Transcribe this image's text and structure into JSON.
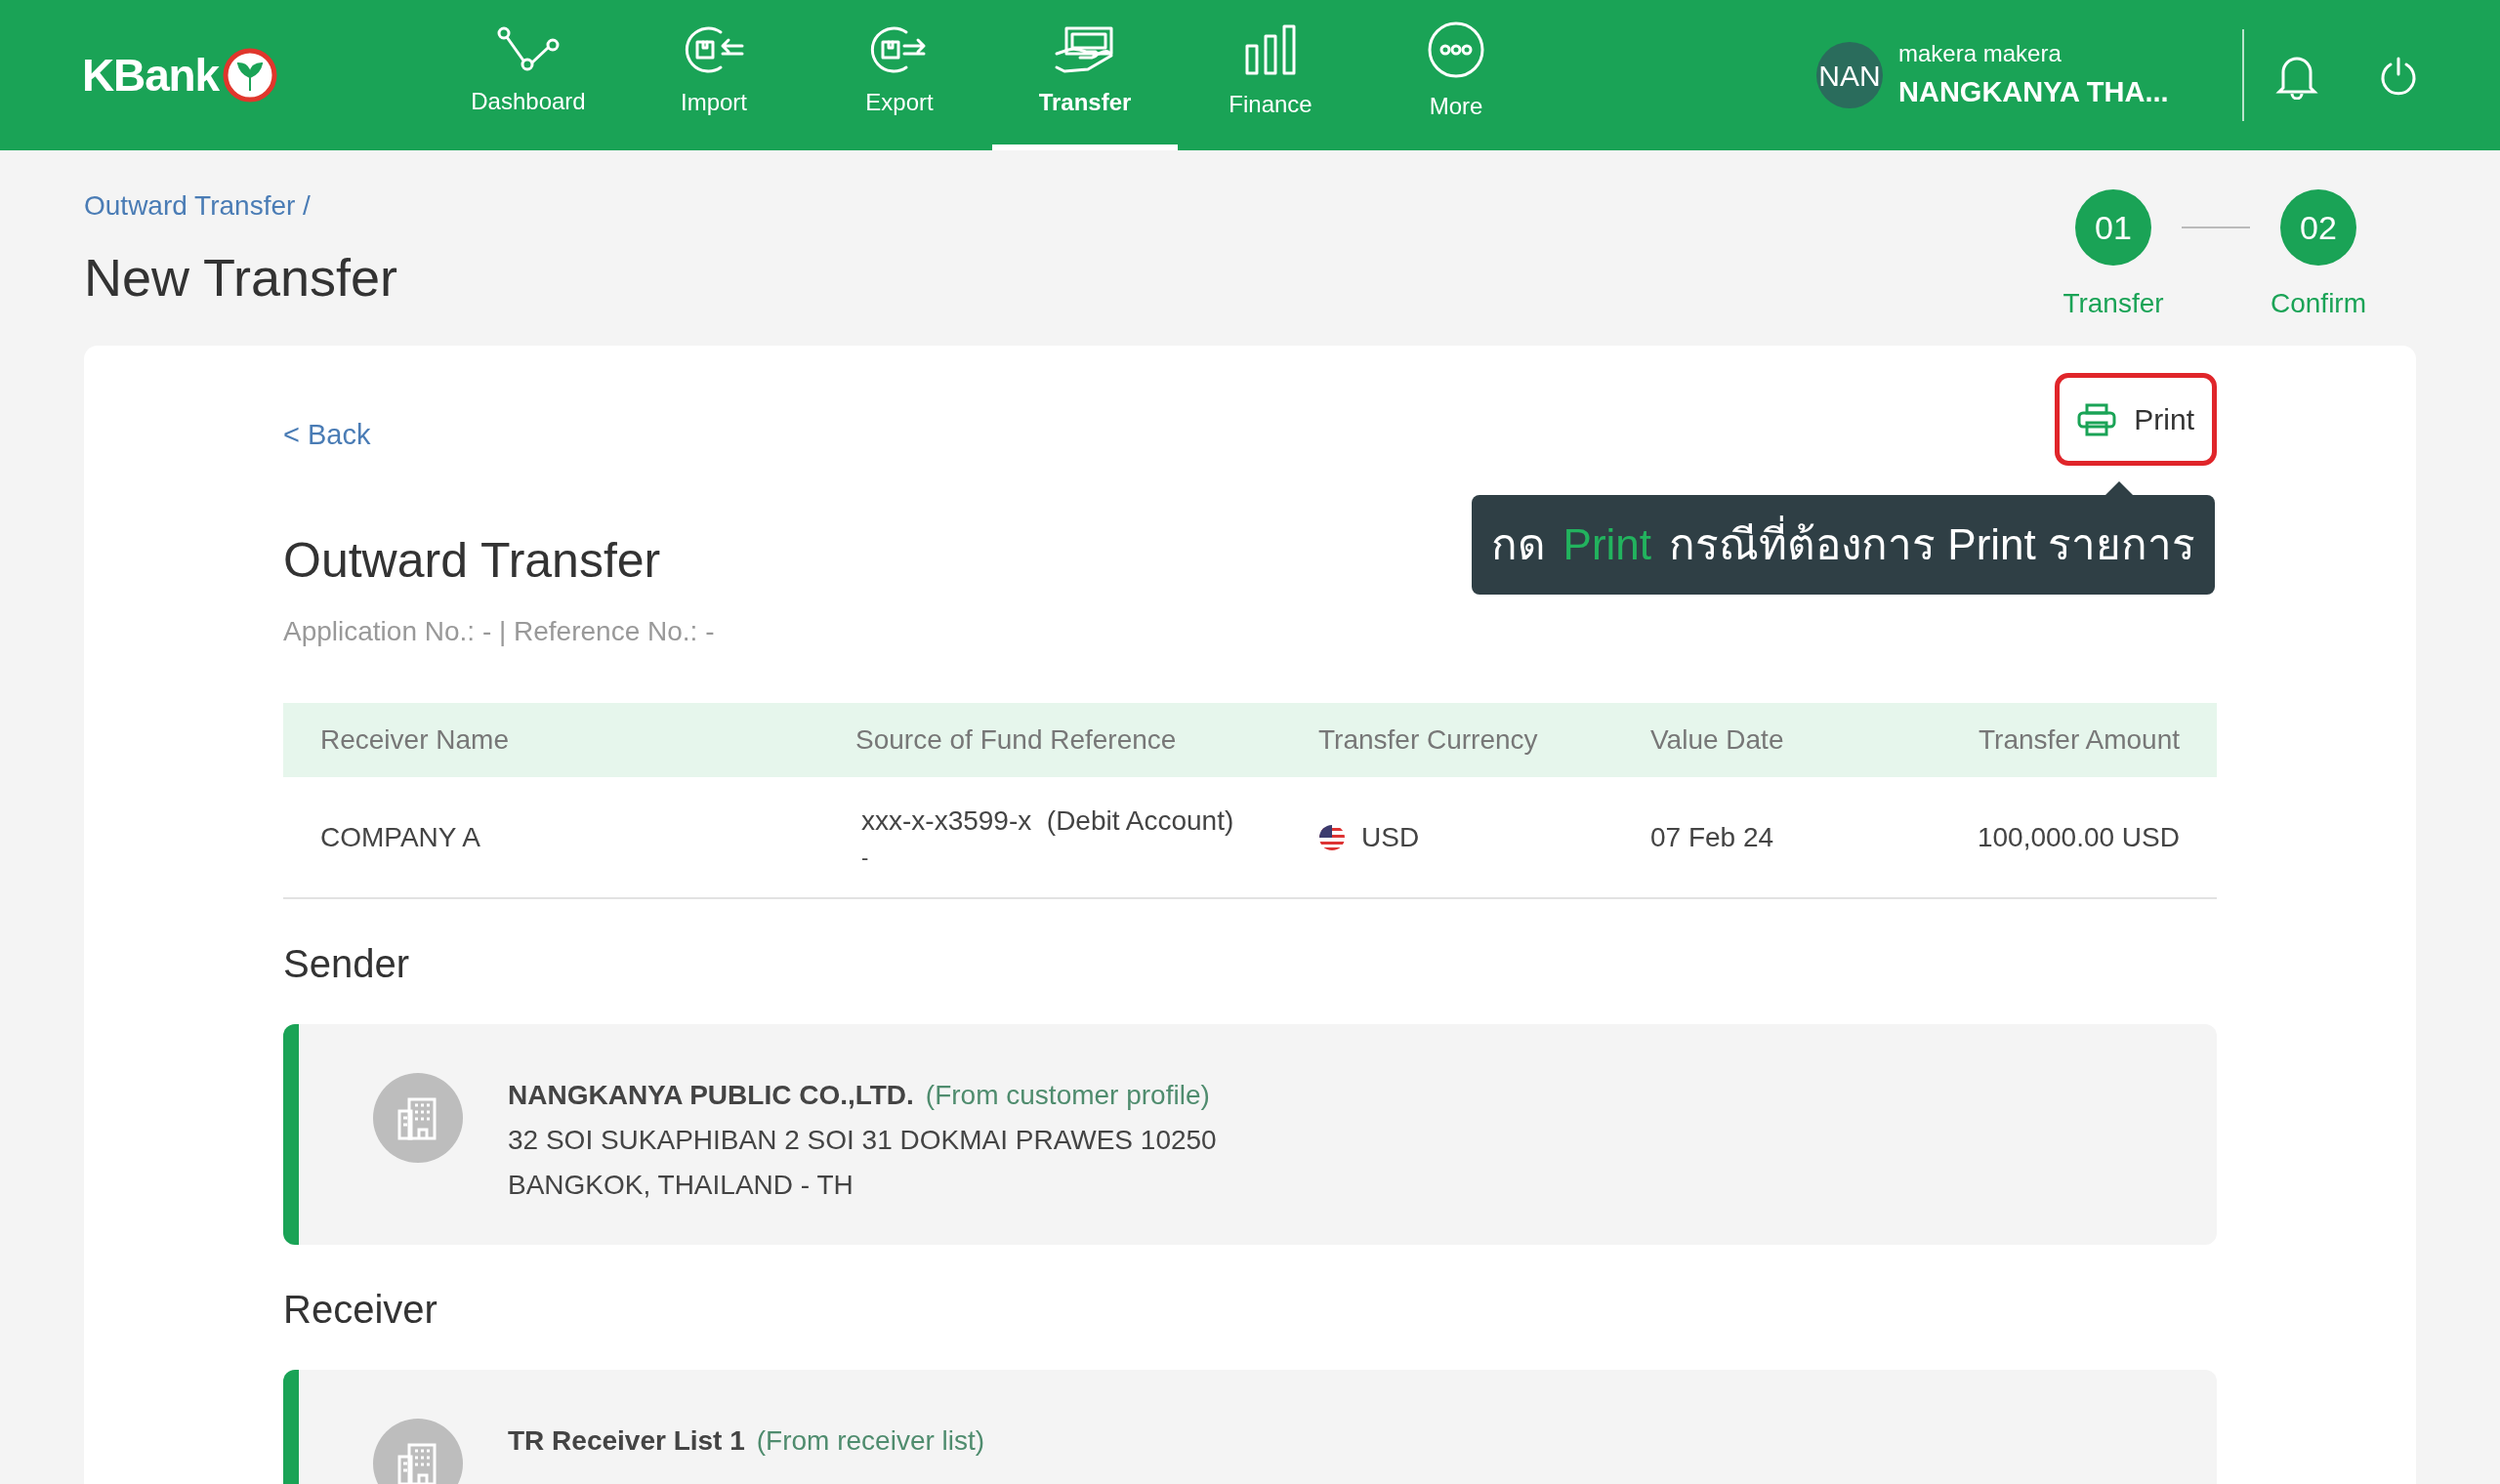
{
  "header": {
    "logo": "KBank",
    "nav": [
      {
        "label": "Dashboard",
        "kind": "dashboard",
        "selected": false
      },
      {
        "label": "Import",
        "kind": "import",
        "selected": false
      },
      {
        "label": "Export",
        "kind": "export",
        "selected": false
      },
      {
        "label": "Transfer",
        "kind": "transfer",
        "selected": true
      },
      {
        "label": "Finance",
        "kind": "finance",
        "selected": false
      },
      {
        "label": "More",
        "kind": "more",
        "selected": false
      }
    ],
    "user": {
      "initials": "NAN",
      "name": "makera makera",
      "company": "NANGKANYA THA..."
    }
  },
  "breadcrumb": "Outward Transfer /",
  "page_title": "New Transfer",
  "steps": [
    {
      "number": "01",
      "label": "Transfer"
    },
    {
      "number": "02",
      "label": "Confirm"
    }
  ],
  "back_link": "< Back",
  "print_button": "Print",
  "tooltip": [
    {
      "text": "กด",
      "highlight": false
    },
    {
      "text": "Print",
      "highlight": true
    },
    {
      "text": "กรณีที่ต้องการ Print รายการ",
      "highlight": false
    }
  ],
  "section_title": "Outward Transfer",
  "section_subtitle": "Application No.: - | Reference No.: -",
  "table": {
    "columns": [
      "Receiver Name",
      "Source of Fund Reference",
      "Transfer Currency",
      "Value Date",
      "Transfer Amount"
    ],
    "rows": [
      {
        "receiver": "COMPANY A",
        "source": "xxx-x-x3599-x  (Debit Account)",
        "source_note": "-",
        "currency": "USD",
        "value_date": "07 Feb 24",
        "amount": "100,000.00 USD"
      }
    ]
  },
  "parties": [
    {
      "heading": "Sender",
      "name": "NANGKANYA PUBLIC CO.,LTD.",
      "origin": "(From customer profile)",
      "lines": [
        "32 SOI SUKAPHIBAN 2 SOI 31 DOKMAI PRAWES 10250",
        "BANGKOK, THAILAND - TH"
      ]
    },
    {
      "heading": "Receiver",
      "name": "TR Receiver List 1",
      "origin": "(From receiver list)"
    }
  ]
}
